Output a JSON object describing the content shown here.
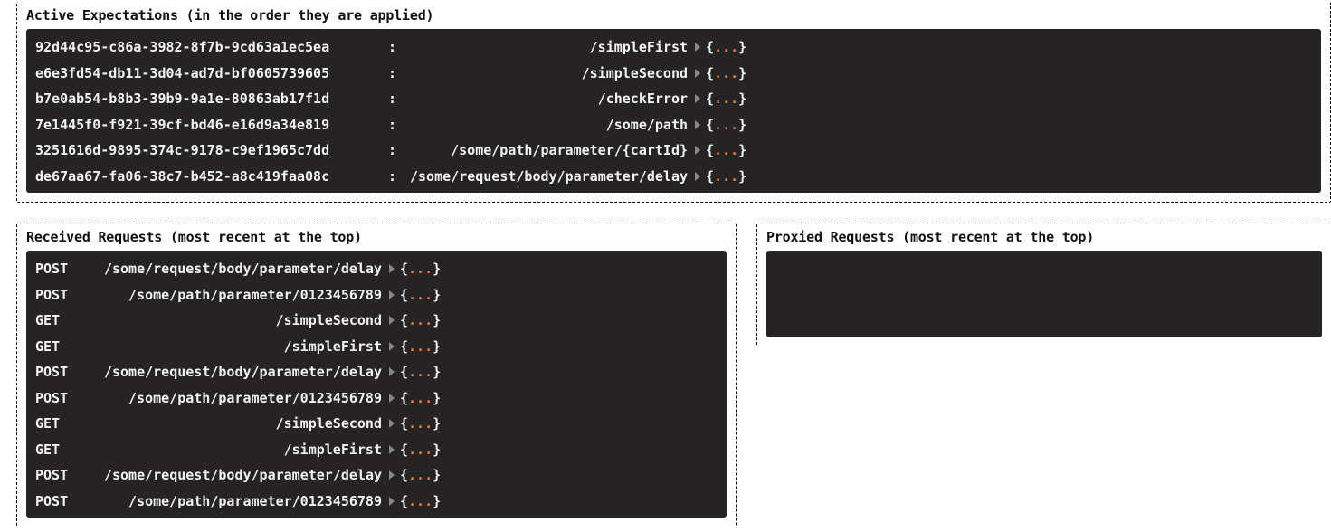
{
  "expectations": {
    "title": "Active Expectations (in the order they are applied)",
    "rows": [
      {
        "id": "92d44c95-c86a-3982-8f7b-9cd63a1ec5ea",
        "path": "/simpleFirst"
      },
      {
        "id": "e6e3fd54-db11-3d04-ad7d-bf0605739605",
        "path": "/simpleSecond"
      },
      {
        "id": "b7e0ab54-b8b3-39b9-9a1e-80863ab17f1d",
        "path": "/checkError"
      },
      {
        "id": "7e1445f0-f921-39cf-bd46-e16d9a34e819",
        "path": "/some/path"
      },
      {
        "id": "3251616d-9895-374c-9178-c9ef1965c7dd",
        "path": "/some/path/parameter/{cartId}"
      },
      {
        "id": "de67aa67-fa06-38c7-b452-a8c419faa08c",
        "path": "/some/request/body/parameter/delay"
      }
    ]
  },
  "received": {
    "title": "Received Requests (most recent at the top)",
    "rows": [
      {
        "method": "POST",
        "path": "/some/request/body/parameter/delay"
      },
      {
        "method": "POST",
        "path": "/some/path/parameter/0123456789"
      },
      {
        "method": "GET",
        "path": "/simpleSecond"
      },
      {
        "method": "GET",
        "path": "/simpleFirst"
      },
      {
        "method": "POST",
        "path": "/some/request/body/parameter/delay"
      },
      {
        "method": "POST",
        "path": "/some/path/parameter/0123456789"
      },
      {
        "method": "GET",
        "path": "/simpleSecond"
      },
      {
        "method": "GET",
        "path": "/simpleFirst"
      },
      {
        "method": "POST",
        "path": "/some/request/body/parameter/delay"
      },
      {
        "method": "POST",
        "path": "/some/path/parameter/0123456789"
      }
    ]
  },
  "proxied": {
    "title": "Proxied Requests (most recent at the top)",
    "rows": []
  },
  "dots": "..."
}
